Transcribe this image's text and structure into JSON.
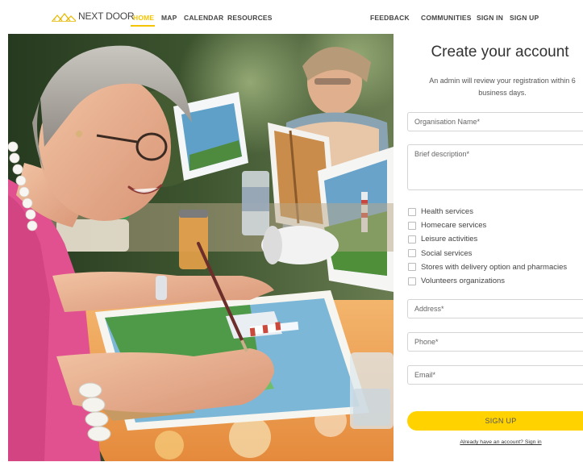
{
  "header": {
    "brand": "NEXT DOOR",
    "nav": {
      "home": "HOME",
      "map": "MAP",
      "calendar": "CALENDAR",
      "resources": "RESOURCES",
      "feedback": "FEEDBACK",
      "communities": "COMMUNITIES",
      "sign_in": "SIGN IN",
      "sign_up": "SIGN UP"
    }
  },
  "form": {
    "title": "Create your account",
    "subtitle": "An admin will review your registration within 6 business days.",
    "organisation_placeholder": "Organisation Name*",
    "description_placeholder": "Brief description*",
    "categories": [
      "Health services",
      "Homecare services",
      "Leisure activities",
      "Social services",
      "Stores with delivery option and pharmacies",
      "Volunteers organizations"
    ],
    "address_placeholder": "Address*",
    "phone_placeholder": "Phone*",
    "email_placeholder": "Email*",
    "signup_label": "SIGN UP",
    "signin_link": "Already have an account? Sign in"
  },
  "colors": {
    "accent": "#ffd200",
    "nav_active": "#f5c400"
  }
}
